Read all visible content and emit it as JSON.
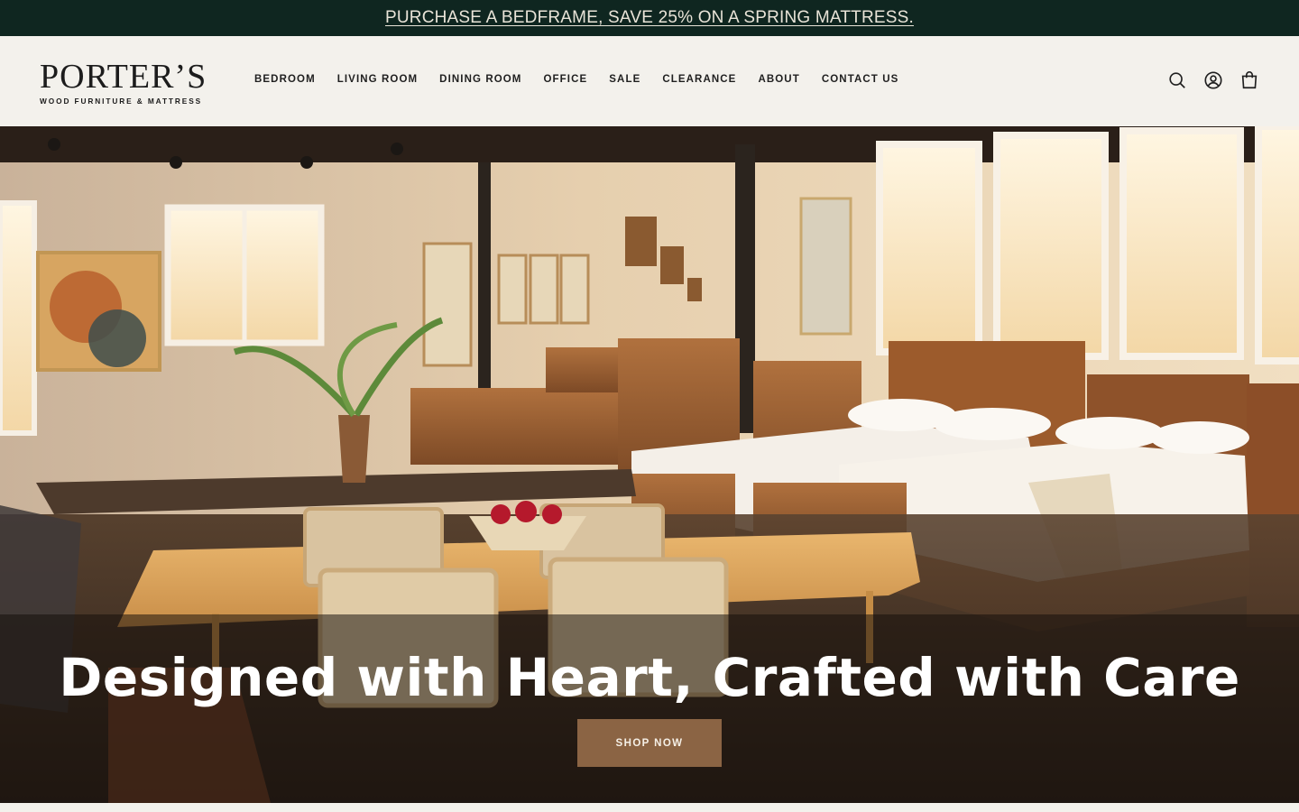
{
  "announcement": {
    "text": "PURCHASE A BEDFRAME, SAVE 25% ON A SPRING MATTRESS."
  },
  "brand": {
    "name": "PORTER’S",
    "tagline": "WOOD FURNITURE & MATTRESS"
  },
  "nav": {
    "items": [
      {
        "label": "BEDROOM"
      },
      {
        "label": "LIVING ROOM"
      },
      {
        "label": "DINING ROOM"
      },
      {
        "label": "OFFICE"
      },
      {
        "label": "SALE"
      },
      {
        "label": "CLEARANCE"
      },
      {
        "label": "ABOUT"
      },
      {
        "label": "CONTACT US"
      }
    ]
  },
  "header_icons": [
    "search-icon",
    "account-icon",
    "cart-icon"
  ],
  "hero": {
    "title": "Designed with Heart, Crafted with Care",
    "cta": "SHOP NOW"
  },
  "colors": {
    "announcement_bg": "#0f2620",
    "header_bg": "#f3f1ec",
    "cta_bg": "#8b6444",
    "text_dark": "#1f1f1f"
  }
}
